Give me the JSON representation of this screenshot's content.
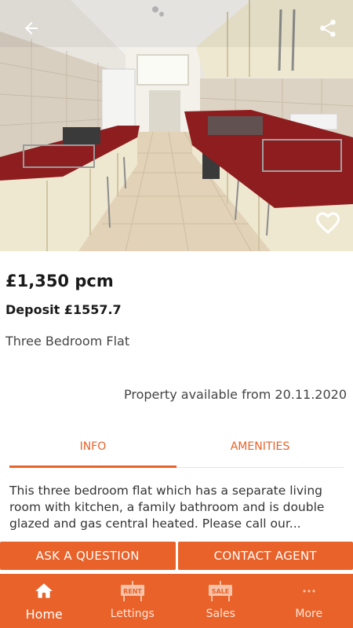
{
  "listing": {
    "price": "£1,350 pcm",
    "deposit": "Deposit £1557.7",
    "property_type": "Three Bedroom Flat",
    "availability": "Property available from 20.11.2020",
    "favourite": false
  },
  "tabs": [
    {
      "label": "INFO",
      "active": true
    },
    {
      "label": "AMENITIES",
      "active": false
    }
  ],
  "description": "This three bedroom flat which has a separate living room with kitchen, a family bathroom and is double glazed and gas central heated.  Please call our...",
  "actions": {
    "ask_label": "ASK A QUESTION",
    "contact_label": "CONTACT AGENT"
  },
  "nav": [
    {
      "label": "Home",
      "icon": "home-icon",
      "active": true
    },
    {
      "label": "Lettings",
      "icon": "rent-sign-icon",
      "badge": "RENT",
      "active": false
    },
    {
      "label": "Sales",
      "icon": "sale-sign-icon",
      "badge": "SALE",
      "active": false
    },
    {
      "label": "More",
      "icon": "more-dots-icon",
      "active": false
    }
  ],
  "colors": {
    "accent": "#e8622a",
    "countertop": "#8e1d1f",
    "cabinet": "#efe8d0"
  },
  "icons": {
    "back": "arrow-back-icon",
    "share": "share-icon",
    "favourite": "heart-outline-icon"
  }
}
